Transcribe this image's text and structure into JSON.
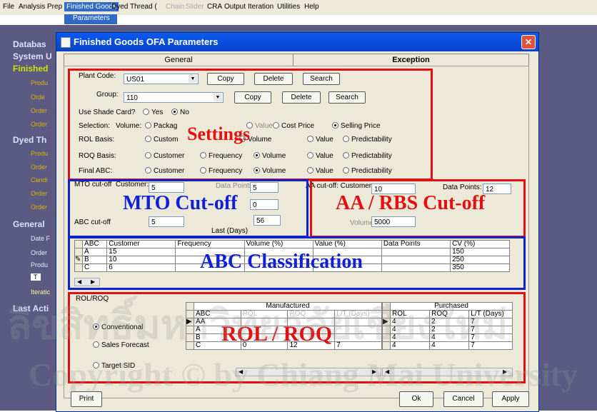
{
  "menu": [
    "File",
    "Analysis Prep",
    "Finished Goods",
    "Dyed Thread (",
    "Chain",
    "Slider",
    "CRA",
    "Output",
    "Iteration",
    "Utilities",
    "Help"
  ],
  "submenu": "Parameters",
  "nav": {
    "headers": [
      "Databas",
      "System U",
      "Finished",
      "Dyed Th",
      "General",
      "Last Acti"
    ],
    "items": [
      "Produ",
      "Orde",
      "Order",
      "Order",
      "Produ",
      "Order",
      "Candi",
      "Order",
      "Order",
      "Date F",
      "Order",
      "Produ",
      "T",
      "Iteratic"
    ]
  },
  "dialog": {
    "title": "Finished Goods OFA Parameters",
    "close": "✕",
    "tabs": [
      "General",
      "Exception"
    ]
  },
  "settings": {
    "plant_code_label": "Plant Code:",
    "plant_code_value": "US01",
    "group_label": "Group:",
    "group_value": "110",
    "copy": "Copy",
    "delete": "Delete",
    "search": "Search",
    "use_shade_label": "Use Shade Card?",
    "yes": "Yes",
    "no": "No",
    "selection_label": "Selection:",
    "selection_prefix": "Volume:",
    "selection_opts": [
      "Packag",
      "Value",
      "Cost Price",
      "Selling Price"
    ],
    "rol_basis_label": "ROL Basis:",
    "roq_basis_label": "ROQ Basis:",
    "final_abc_label": "Final ABC:",
    "basis_opts": [
      "Customer",
      "Frequency",
      "Volume",
      "Value",
      "Predictability"
    ],
    "rol_opts": [
      "Custom",
      "Volume",
      "Value",
      "Predictability"
    ]
  },
  "mto": {
    "label": "MTO cut-off",
    "customer": "Customer:",
    "customer_val": "5",
    "data_points": "Data Points:",
    "data_points_val": "5",
    "mid_val": "0",
    "abc_label": "ABC cut-off",
    "abc_val": "5",
    "last_days": "Last (Days)",
    "last_days_val": "56"
  },
  "aa": {
    "label": "AA cut-off: Customer:",
    "customer_val": "10",
    "data_points": "Data Points:",
    "data_points_val": "12",
    "volume_label": "Volume",
    "volume_val": "5000"
  },
  "abc_grid": {
    "headers": [
      "ABC",
      "Customer",
      "Frequency",
      "Volume (%)",
      "Value (%)",
      "Data Points",
      "CV (%)"
    ],
    "rows": [
      [
        "A",
        "15",
        "",
        "",
        "",
        "",
        "150"
      ],
      [
        "B",
        "10",
        "",
        "",
        "",
        "",
        "250"
      ],
      [
        "C",
        "6",
        "",
        "",
        "",
        "",
        "350"
      ]
    ]
  },
  "rolroq": {
    "title": "ROL/ROQ",
    "options": [
      "Conventional",
      "Sales Forecast",
      "Target SID"
    ],
    "manufactured": "Manufactured",
    "purchased": "Purchased",
    "m_headers": [
      "ABC",
      "ROL",
      "ROQ",
      "L/T (Days)"
    ],
    "p_headers": [
      "ROL",
      "ROQ",
      "L/T (Days)"
    ],
    "m_rows": [
      [
        "AA",
        "",
        "",
        ""
      ],
      [
        "A",
        "",
        "",
        ""
      ],
      [
        "B",
        "",
        "",
        ""
      ],
      [
        "C",
        "0",
        "12",
        "7"
      ]
    ],
    "p_rows": [
      [
        "4",
        "2",
        "7"
      ],
      [
        "4",
        "2",
        "7"
      ],
      [
        "4",
        "4",
        "7"
      ],
      [
        "4",
        "4",
        "7"
      ]
    ]
  },
  "overlay": {
    "settings": "Settings",
    "mto": "MTO Cut-off",
    "aa": "AA / RBS Cut-off",
    "abc": "ABC Classification",
    "rol": "ROL / ROQ"
  },
  "footer": {
    "print": "Print",
    "ok": "Ok",
    "cancel": "Cancel",
    "apply": "Apply"
  },
  "watermark": {
    "line1": "ลิขสิทธิ์มหาวิทยาลัยเชียงใหม่",
    "line2": "Copyright © by Chiang Mai University"
  },
  "colors": {
    "annotation_red": "#e01010",
    "annotation_blue": "#0a22d0",
    "nav_bg": "#5a5a83",
    "title_bar": "#0a5cf0"
  }
}
